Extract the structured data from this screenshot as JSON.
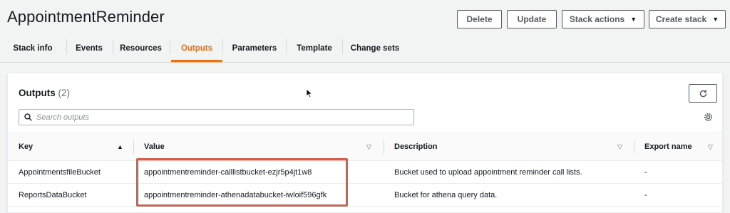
{
  "header": {
    "title": "AppointmentReminder",
    "buttons": {
      "delete": "Delete",
      "update": "Update",
      "stack_actions": "Stack actions",
      "create_stack": "Create stack"
    }
  },
  "tabs": [
    {
      "label": "Stack info"
    },
    {
      "label": "Events"
    },
    {
      "label": "Resources"
    },
    {
      "label": "Outputs",
      "active": true
    },
    {
      "label": "Parameters"
    },
    {
      "label": "Template"
    },
    {
      "label": "Change sets"
    }
  ],
  "panel": {
    "title": "Outputs",
    "count": "(2)",
    "search_placeholder": "Search outputs"
  },
  "table": {
    "columns": [
      "Key",
      "Value",
      "Description",
      "Export name"
    ],
    "rows": [
      {
        "key": "AppointmentsfileBucket",
        "value": "appointmentreminder-calllistbucket-ezjr5p4jt1w8",
        "description": "Bucket used to upload appointment reminder call lists.",
        "export": "-"
      },
      {
        "key": "ReportsDataBucket",
        "value": "appointmentreminder-athenadatabucket-iwloif596gfk",
        "description": "Bucket for athena query data.",
        "export": "-"
      }
    ]
  },
  "colors": {
    "accent": "#ec7211",
    "highlight": "#e05a47",
    "text": "#16191f",
    "background": "#f2f3f3"
  },
  "icons": [
    "search-icon",
    "refresh-icon",
    "settings-icon",
    "sort-ascending-icon",
    "sort-icon",
    "caret-down-icon",
    "mouse-cursor-icon"
  ]
}
